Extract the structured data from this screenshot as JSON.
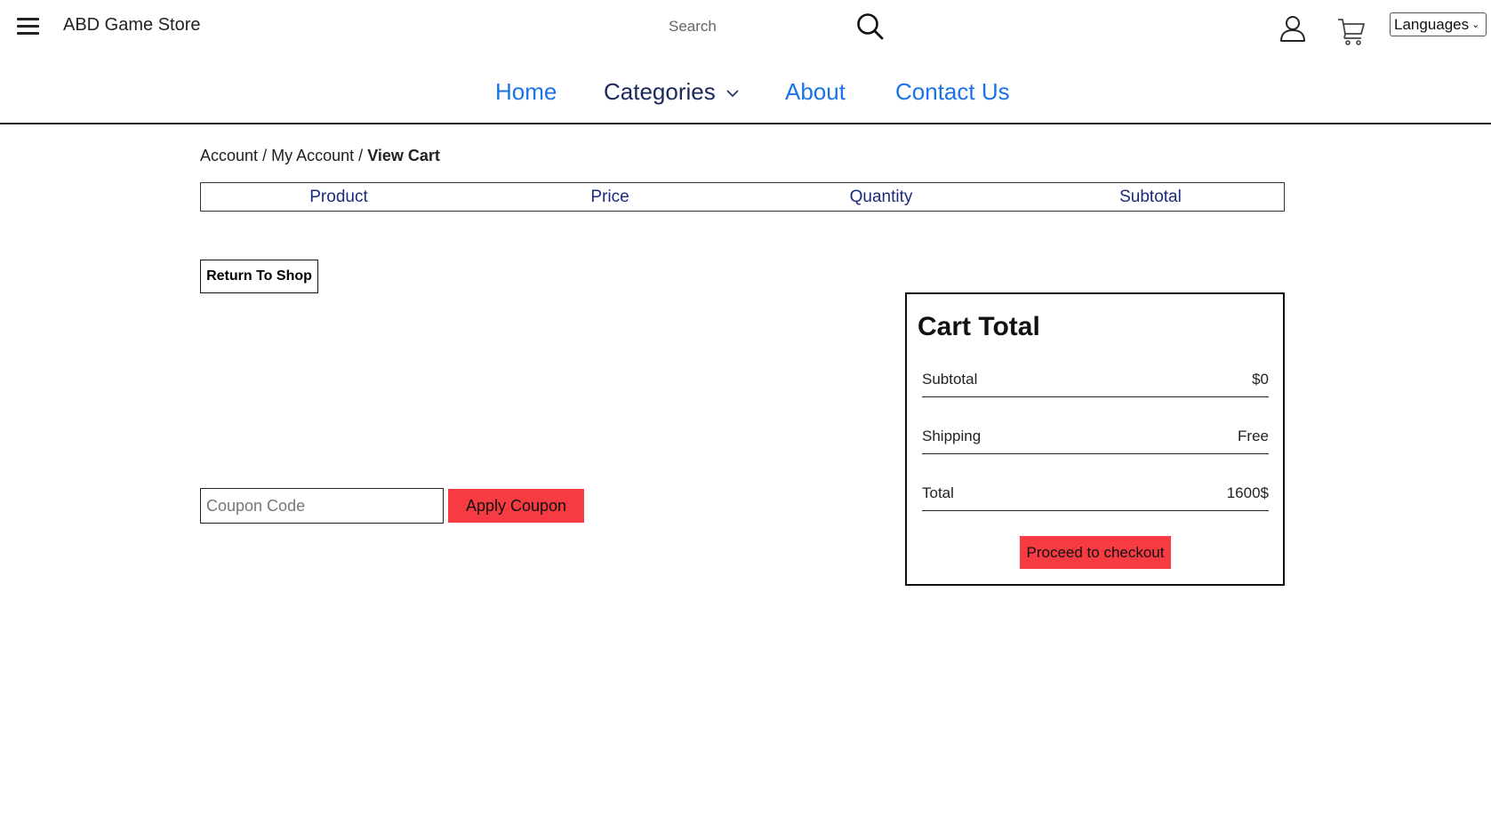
{
  "header": {
    "brand": "ABD Game Store",
    "search_placeholder": "Search",
    "languages_label": "Languages",
    "icons": {
      "menu": "hamburger-menu-icon",
      "search": "search-icon",
      "account": "user-icon",
      "cart": "shopping-cart-icon"
    }
  },
  "nav": {
    "items": [
      {
        "label": "Home"
      },
      {
        "label": "Categories"
      },
      {
        "label": "About"
      },
      {
        "label": "Contact Us"
      }
    ]
  },
  "breadcrumb": {
    "account": "Account",
    "my_account": "My Account",
    "current": "View Cart",
    "separator": "/"
  },
  "cart_table": {
    "columns": [
      "Product",
      "Price",
      "Quantity",
      "Subtotal"
    ]
  },
  "actions": {
    "return_to_shop": "Return To Shop",
    "coupon_placeholder": "Coupon Code",
    "apply_coupon": "Apply Coupon"
  },
  "cart_total": {
    "title": "Cart Total",
    "rows": [
      {
        "label": "Subtotal",
        "value": "$0"
      },
      {
        "label": "Shipping",
        "value": "Free"
      },
      {
        "label": "Total",
        "value": "1600$"
      }
    ],
    "checkout_label": "Proceed to checkout"
  },
  "colors": {
    "accent_red": "#f63c42",
    "nav_blue": "#1a73e8",
    "nav_dark": "#1b2a5a"
  }
}
